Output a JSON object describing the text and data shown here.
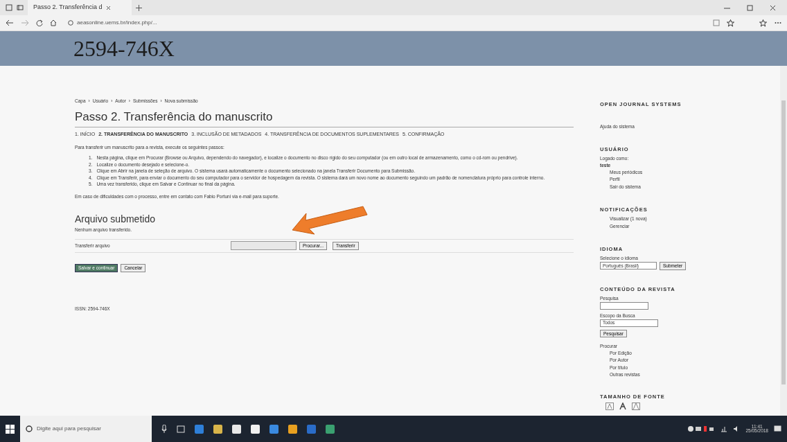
{
  "browser": {
    "tab_title": "Passo 2. Transferência d",
    "url": "aeasonline.uems.br/index.php/..."
  },
  "header": {
    "title": "2594-746X"
  },
  "breadcrumb": {
    "separator": "›",
    "items": [
      "Capa",
      "Usuário",
      "Autor",
      "Submissões",
      "Nova submissão"
    ]
  },
  "page_title": "Passo 2. Transferência do manuscrito",
  "steps": [
    {
      "label": "1. INÍCIO",
      "selected": false
    },
    {
      "label": "2. TRANSFERÊNCIA DO MANUSCRITO",
      "selected": true
    },
    {
      "label": "3. INCLUSÃO DE METADADOS",
      "selected": false
    },
    {
      "label": "4. TRANSFERÊNCIA DE DOCUMENTOS SUPLEMENTARES",
      "selected": false
    },
    {
      "label": "5. CONFIRMAÇÃO",
      "selected": false
    }
  ],
  "intro": "Para transferir um manuscrito para a revista, execute os seguintes passos:",
  "instructions": [
    {
      "number": "1.",
      "text": "Nesta página, clique em Procurar (Browse ou Arquivo, dependendo do navegador), e localize o documento no disco rígido do seu computador (ou em outro local de armazenamento, como o cd-rom ou pendrive)."
    },
    {
      "number": "2.",
      "text": "Localize o documento desejado e selecione-o."
    },
    {
      "number": "3.",
      "text": "Clique em Abrir na janela de seleção de arquivo. O sistema usará automaticamente o documento selecionado na janela Transferir Documento para Submissão."
    },
    {
      "number": "4.",
      "text": "Clique em Transferir, para enviar o documento do seu computador para o servidor de hospedagem da revista. O sistema dará um novo nome ao documento seguindo um padrão de nomenclatura próprio para controle interno."
    },
    {
      "number": "5.",
      "text": "Uma vez transferido, clique em Salvar e Continuar no final da página."
    }
  ],
  "help_text": "Em caso de dificuldades com o processo, entre em contato com Fabio Portuni via e-mail para suporte.",
  "file_section": {
    "title": "Arquivo submetido",
    "status": "Nenhum arquivo transferido.",
    "label": "Transferir arquivo",
    "browse_button": "Procurar...",
    "upload_button": "Transferir"
  },
  "buttons": [
    {
      "label": "Salvar e continuar",
      "kind": "primary"
    },
    {
      "label": "Cancelar",
      "kind": "secondary"
    }
  ],
  "footer": "ISSN: 2594-746X",
  "sidebar": {
    "brand": "OPEN JOURNAL SYSTEMS",
    "help_link": "Ajuda do sistema",
    "user": {
      "title": "USUÁRIO",
      "logged_in_as": "Logado como:",
      "username": "teste",
      "links": [
        "Meus periódicos",
        "Perfil",
        "Sair do sistema"
      ]
    },
    "notifications": {
      "title": "NOTIFICAÇÕES",
      "links": [
        "Visualizar (1 nova)",
        "Gerenciar"
      ]
    },
    "language": {
      "title": "IDIOMA",
      "label": "Selecione o idioma",
      "value": "Português (Brasil)",
      "button": "Submeter"
    },
    "content": {
      "title": "CONTEÚDO DA REVISTA",
      "search_label": "Pesquisa",
      "scope_label": "Escopo da Busca",
      "scope_value": "Todos",
      "search_button": "Pesquisar",
      "browse_label": "Procurar",
      "browse_links": [
        "Por Edição",
        "Por Autor",
        "Por título",
        "Outras revistas"
      ]
    },
    "font_size": {
      "title": "TAMANHO DE FONTE"
    }
  },
  "taskbar": {
    "search_placeholder": "Digite aqui para pesquisar",
    "time": "11:41",
    "date": "25/05/2018"
  }
}
